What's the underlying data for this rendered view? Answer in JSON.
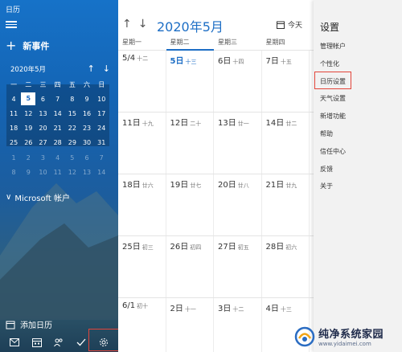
{
  "app": {
    "title": "日历"
  },
  "sidebar": {
    "new_event": "新事件",
    "mini_month": "2020年5月",
    "weekdays": [
      "一",
      "二",
      "三",
      "四",
      "五",
      "六",
      "日"
    ],
    "mini_rows": [
      [
        "27",
        "28",
        "29",
        "30",
        "1",
        "2",
        "3"
      ],
      [
        "4",
        "5",
        "6",
        "7",
        "8",
        "9",
        "10"
      ],
      [
        "11",
        "12",
        "13",
        "14",
        "15",
        "16",
        "17"
      ],
      [
        "18",
        "19",
        "20",
        "21",
        "22",
        "23",
        "24"
      ],
      [
        "25",
        "26",
        "27",
        "28",
        "29",
        "30",
        "31"
      ],
      [
        "1",
        "2",
        "3",
        "4",
        "5",
        "6",
        "7"
      ],
      [
        "8",
        "9",
        "10",
        "11",
        "12",
        "13",
        "14"
      ]
    ],
    "account": "Microsoft 帐户",
    "add_calendar": "添加日历"
  },
  "main": {
    "month_title": "2020年5月",
    "today_label": "今天",
    "weekday_headers": [
      "星期一",
      "星期二",
      "星期三",
      "星期四"
    ],
    "rows": [
      [
        {
          "d": "5/4",
          "l": "十二"
        },
        {
          "d": "5日",
          "l": "十三"
        },
        {
          "d": "6日",
          "l": "十四"
        },
        {
          "d": "7日",
          "l": "十五"
        }
      ],
      [
        {
          "d": "11日",
          "l": "十九"
        },
        {
          "d": "12日",
          "l": "二十"
        },
        {
          "d": "13日",
          "l": "廿一"
        },
        {
          "d": "14日",
          "l": "廿二"
        }
      ],
      [
        {
          "d": "18日",
          "l": "廿六"
        },
        {
          "d": "19日",
          "l": "廿七"
        },
        {
          "d": "20日",
          "l": "廿八"
        },
        {
          "d": "21日",
          "l": "廿九"
        }
      ],
      [
        {
          "d": "25日",
          "l": "初三"
        },
        {
          "d": "26日",
          "l": "初四"
        },
        {
          "d": "27日",
          "l": "初五"
        },
        {
          "d": "28日",
          "l": "初六"
        }
      ],
      [
        {
          "d": "6/1",
          "l": "初十"
        },
        {
          "d": "2日",
          "l": "十一"
        },
        {
          "d": "3日",
          "l": "十二"
        },
        {
          "d": "4日",
          "l": "十三"
        }
      ]
    ]
  },
  "settings": {
    "title": "设置",
    "items": [
      "管理帐户",
      "个性化",
      "日历设置",
      "天气设置",
      "新增功能",
      "帮助",
      "信任中心",
      "反馈",
      "关于"
    ]
  },
  "watermark": {
    "title": "纯净系统家园",
    "url": "www.yidaimei.com"
  },
  "colors": {
    "accent": "#1d6ec5",
    "highlight_box": "#e3453a"
  }
}
